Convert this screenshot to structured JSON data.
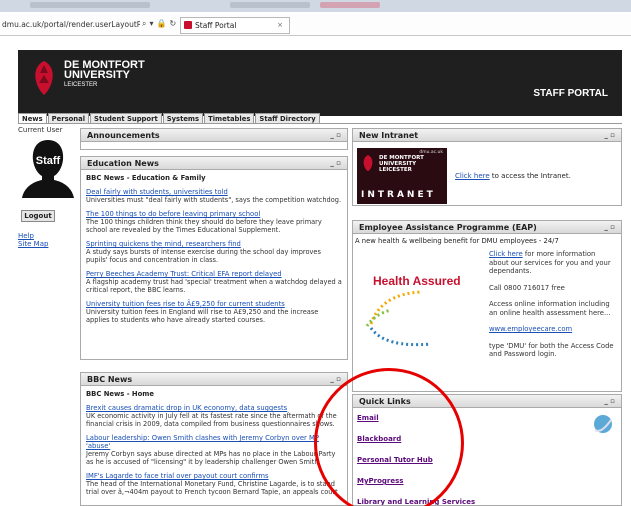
{
  "browser": {
    "url": "dmu.ac.uk/portal/render.userLayoutRoot",
    "tab_title": "Staff Portal",
    "tab_close": "×",
    "icons": [
      "search-icon",
      "dropdown-icon",
      "lock-icon",
      "refresh-icon"
    ]
  },
  "header": {
    "logo_line1": "DE MONTFORT",
    "logo_line2": "UNIVERSITY",
    "logo_line3": "LEICESTER",
    "portal_title": "STAFF PORTAL"
  },
  "nav": {
    "tabs": [
      "News",
      "Personal",
      "Student Support",
      "Systems",
      "Timetables",
      "Staff Directory"
    ]
  },
  "left": {
    "current_user": "Current User",
    "avatar_label": "Staff",
    "logout": "Logout",
    "help": "Help",
    "sitemap": "Site Map"
  },
  "announcements": {
    "title": "Announcements",
    "controls": "_ ▫"
  },
  "education_news": {
    "title": "Education News",
    "controls": "_ ▫",
    "subheading": "BBC News - Education & Family",
    "items": [
      {
        "title": "Deal fairly with students, universities told",
        "desc": "Universities must \"deal fairly with students\", says the competition watchdog."
      },
      {
        "title": "The 100 things to do before leaving primary school",
        "desc": "The 100 things children think they should do before they leave primary school are revealed by the Times Educational Supplement."
      },
      {
        "title": "Sprinting quickens the mind, researchers find",
        "desc": "A study says bursts of intense exercise during the school day improves pupils' focus and concentration in class."
      },
      {
        "title": "Perry Beeches Academy Trust: Critical EFA report delayed",
        "desc": "A flagship academy trust had 'special' treatment when a watchdog delayed a critical report, the BBC learns."
      },
      {
        "title": "University tuition fees rise to Â£9,250 for current students",
        "desc": "University tuition fees in England will rise to Â£9,250 and the increase applies to students who have already started courses."
      }
    ]
  },
  "bbc_news": {
    "title": "BBC News",
    "controls": "_ ▫",
    "subheading": "BBC News - Home",
    "items": [
      {
        "title": "Brexit causes dramatic drop in UK economy, data suggests",
        "desc": "UK economic activity in July fell at its fastest rate since the aftermath of the financial crisis in 2009, data compiled from business questionnaires shows."
      },
      {
        "title": "Labour leadership: Owen Smith clashes with Jeremy Corbyn over MP 'abuse'",
        "desc": "Jeremy Corbyn says abuse directed at MPs has no place in the Labour Party as he is accused of \"licensing\" it by leadership challenger Owen Smith."
      },
      {
        "title": "IMF's Lagarde to face trial over payout court confirms",
        "desc": "The head of the International Monetary Fund, Christine Lagarde, is to stand trial over â‚¬404m payout to French tycoon Bernard Tapie, an appeals court"
      }
    ]
  },
  "intranet": {
    "title": "New Intranet",
    "controls": "_ ▫",
    "logo_url": "dmu.ac.uk",
    "logo_word": "INTRANET",
    "link_text": "Click here",
    "rest_text": " to access the Intranet."
  },
  "eap": {
    "title": "Employee Assistance Programme (EAP)",
    "controls": "_ ▫",
    "intro": "A new health & wellbeing benefit for DMU employees - 24/7",
    "logo_text": "Health Assured",
    "p1_link": "Click here",
    "p1_rest": " for more information about our services for you and your dependants.",
    "p2": "Call 0800 716017 free",
    "p3": "Access online information including an online health assessment here...",
    "p4_link": "www.employeecare.com",
    "p5": "type 'DMU' for both the Access Code and Password login."
  },
  "quick_links": {
    "title": "Quick Links",
    "controls": "_ ▫",
    "items": [
      "Email",
      "Blackboard",
      "Personal Tutor Hub",
      "MyProgress",
      "Library and Learning Services"
    ]
  },
  "colors": {
    "banner": "#1f1f1f",
    "accent_red": "#c8102e",
    "link_blue": "#1a4fb5",
    "circle": "#e60000"
  }
}
